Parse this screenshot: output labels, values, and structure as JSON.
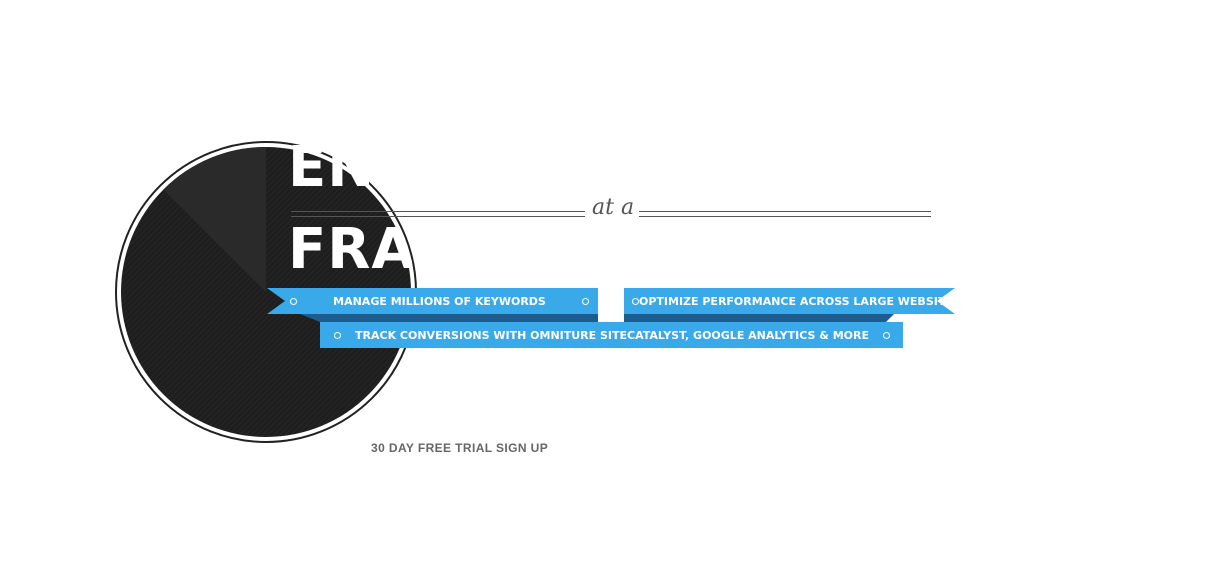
{
  "headline": {
    "top_fragment": "EN",
    "bottom_fragment": "FRAG",
    "script_word": "at a"
  },
  "features": [
    {
      "label": "MANAGE MILLIONS OF KEYWORDS"
    },
    {
      "label": "OPTIMIZE PERFORMANCE ACROSS LARGE WEBSITES"
    },
    {
      "label": "TRACK CONVERSIONS WITH OMNITURE SITECATALYST, GOOGLE ANALYTICS & MORE"
    }
  ],
  "cta": {
    "label": "30 DAY FREE TRIAL SIGN UP"
  },
  "colors": {
    "ribbon": "#3aa9ea",
    "ribbon_fold": "#1d5c8e",
    "pie_dark": "#1e1e1e",
    "pie_slice": "#2a2a2a",
    "cta_text": "#666666"
  },
  "icons": [
    "pie-chart-graphic",
    "ribbon-dot-icon"
  ]
}
